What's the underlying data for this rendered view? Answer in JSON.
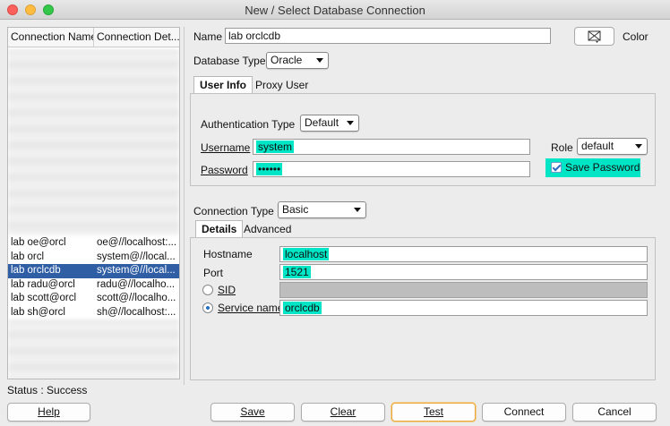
{
  "window": {
    "title": "New / Select Database Connection"
  },
  "connection_list": {
    "columns": [
      "Connection Name",
      "Connection Det..."
    ],
    "rows": [
      {
        "name": "lab oe@orcl",
        "details": "oe@//localhost:..."
      },
      {
        "name": "lab orcl",
        "details": "system@//local..."
      },
      {
        "name": "lab orclcdb",
        "details": "system@//local...",
        "selected": true
      },
      {
        "name": "lab radu@orcl",
        "details": "radu@//localho..."
      },
      {
        "name": "lab scott@orcl",
        "details": "scott@//localho..."
      },
      {
        "name": "lab sh@orcl",
        "details": "sh@//localhost:..."
      }
    ]
  },
  "form": {
    "name_label": "Name",
    "name_value": "lab orclcdb",
    "color_label": "Color",
    "database_type_label": "Database Type",
    "database_type_value": "Oracle",
    "tabs": [
      "User Info",
      "Proxy User"
    ],
    "auth_type_label": "Authentication Type",
    "auth_type_value": "Default",
    "username_label": "Username",
    "username_value": "system",
    "role_label": "Role",
    "role_value": "default",
    "password_label": "Password",
    "password_value": "••••••",
    "save_password_label": "Save Password",
    "save_password_checked": true,
    "connection_type_label": "Connection Type",
    "connection_type_value": "Basic",
    "details_tabs": [
      "Details",
      "Advanced"
    ],
    "hostname_label": "Hostname",
    "hostname_value": "localhost",
    "port_label": "Port",
    "port_value": "1521",
    "sid_label": "SID",
    "service_name_label": "Service name",
    "service_name_value": "orclcdb",
    "selected_radio": "service_name"
  },
  "status": {
    "text": "Status : Success"
  },
  "buttons": {
    "help": "Help",
    "save": "Save",
    "clear": "Clear",
    "test": "Test",
    "connect": "Connect",
    "cancel": "Cancel"
  },
  "colors": {
    "highlight": "#00e5c5",
    "selection": "#2f5ea5",
    "focus_ring": "#e9a741"
  }
}
